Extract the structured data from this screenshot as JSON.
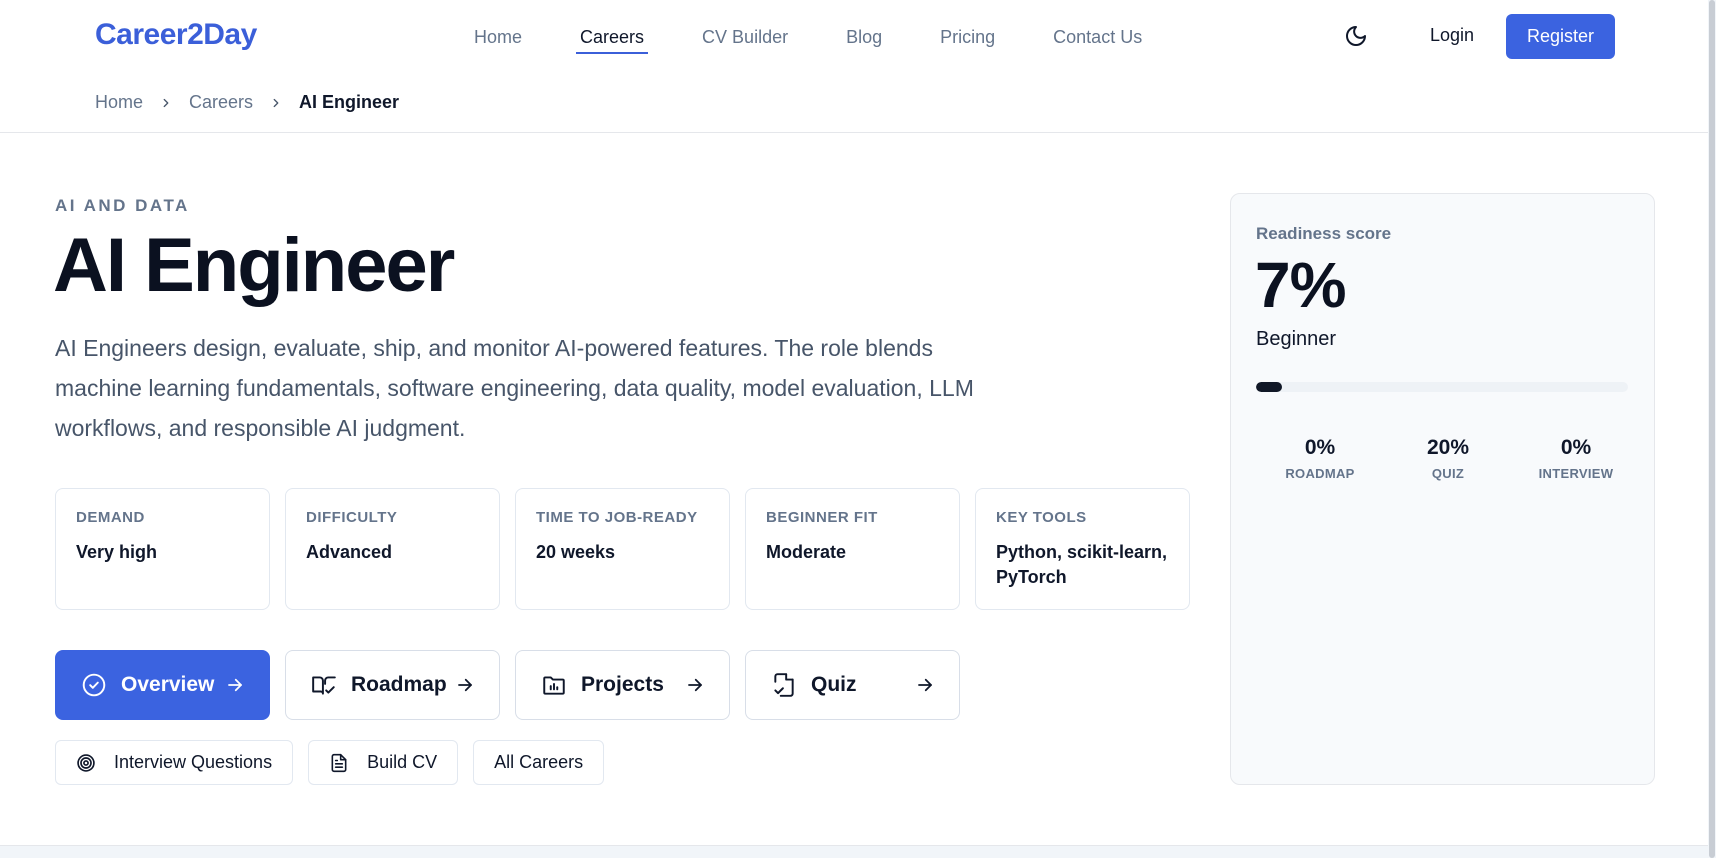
{
  "brand": {
    "name": "Career2Day",
    "accent": "#3b63e0"
  },
  "nav": {
    "items": [
      {
        "label": "Home",
        "active": false
      },
      {
        "label": "Careers",
        "active": true
      },
      {
        "label": "CV Builder",
        "active": false
      },
      {
        "label": "Blog",
        "active": false
      },
      {
        "label": "Pricing",
        "active": false
      },
      {
        "label": "Contact Us",
        "active": false
      }
    ],
    "theme_icon": "moon-icon",
    "login": "Login",
    "register": "Register"
  },
  "breadcrumb": {
    "items": [
      "Home",
      "Careers"
    ],
    "current": "AI Engineer"
  },
  "hero": {
    "category": "AI AND DATA",
    "title": "AI Engineer",
    "description": "AI Engineers design, evaluate, ship, and monitor AI-powered features. The role blends machine learning fundamentals, software engineering, data quality, model evaluation, LLM workflows, and responsible AI judgment."
  },
  "stats": [
    {
      "key": "DEMAND",
      "value": "Very high"
    },
    {
      "key": "DIFFICULTY",
      "value": "Advanced"
    },
    {
      "key": "TIME TO JOB-READY",
      "value": "20 weeks"
    },
    {
      "key": "BEGINNER FIT",
      "value": "Moderate"
    },
    {
      "key": "KEY TOOLS",
      "value": "Python, scikit-learn, PyTorch"
    }
  ],
  "tabs": [
    {
      "label": "Overview",
      "icon": "check-circle-icon",
      "primary": true
    },
    {
      "label": "Roadmap",
      "icon": "book-open-icon",
      "primary": false
    },
    {
      "label": "Projects",
      "icon": "folder-chart-icon",
      "primary": false
    },
    {
      "label": "Quiz",
      "icon": "file-check-icon",
      "primary": false
    }
  ],
  "links": [
    {
      "label": "Interview Questions",
      "icon": "target-icon"
    },
    {
      "label": "Build CV",
      "icon": "document-icon"
    },
    {
      "label": "All Careers",
      "icon": ""
    }
  ],
  "readiness": {
    "label": "Readiness score",
    "score": "7%",
    "level": "Beginner",
    "progress": 0.07,
    "breakdown": [
      {
        "value": "0%",
        "label": "ROADMAP"
      },
      {
        "value": "20%",
        "label": "QUIZ"
      },
      {
        "value": "0%",
        "label": "INTERVIEW"
      }
    ]
  }
}
